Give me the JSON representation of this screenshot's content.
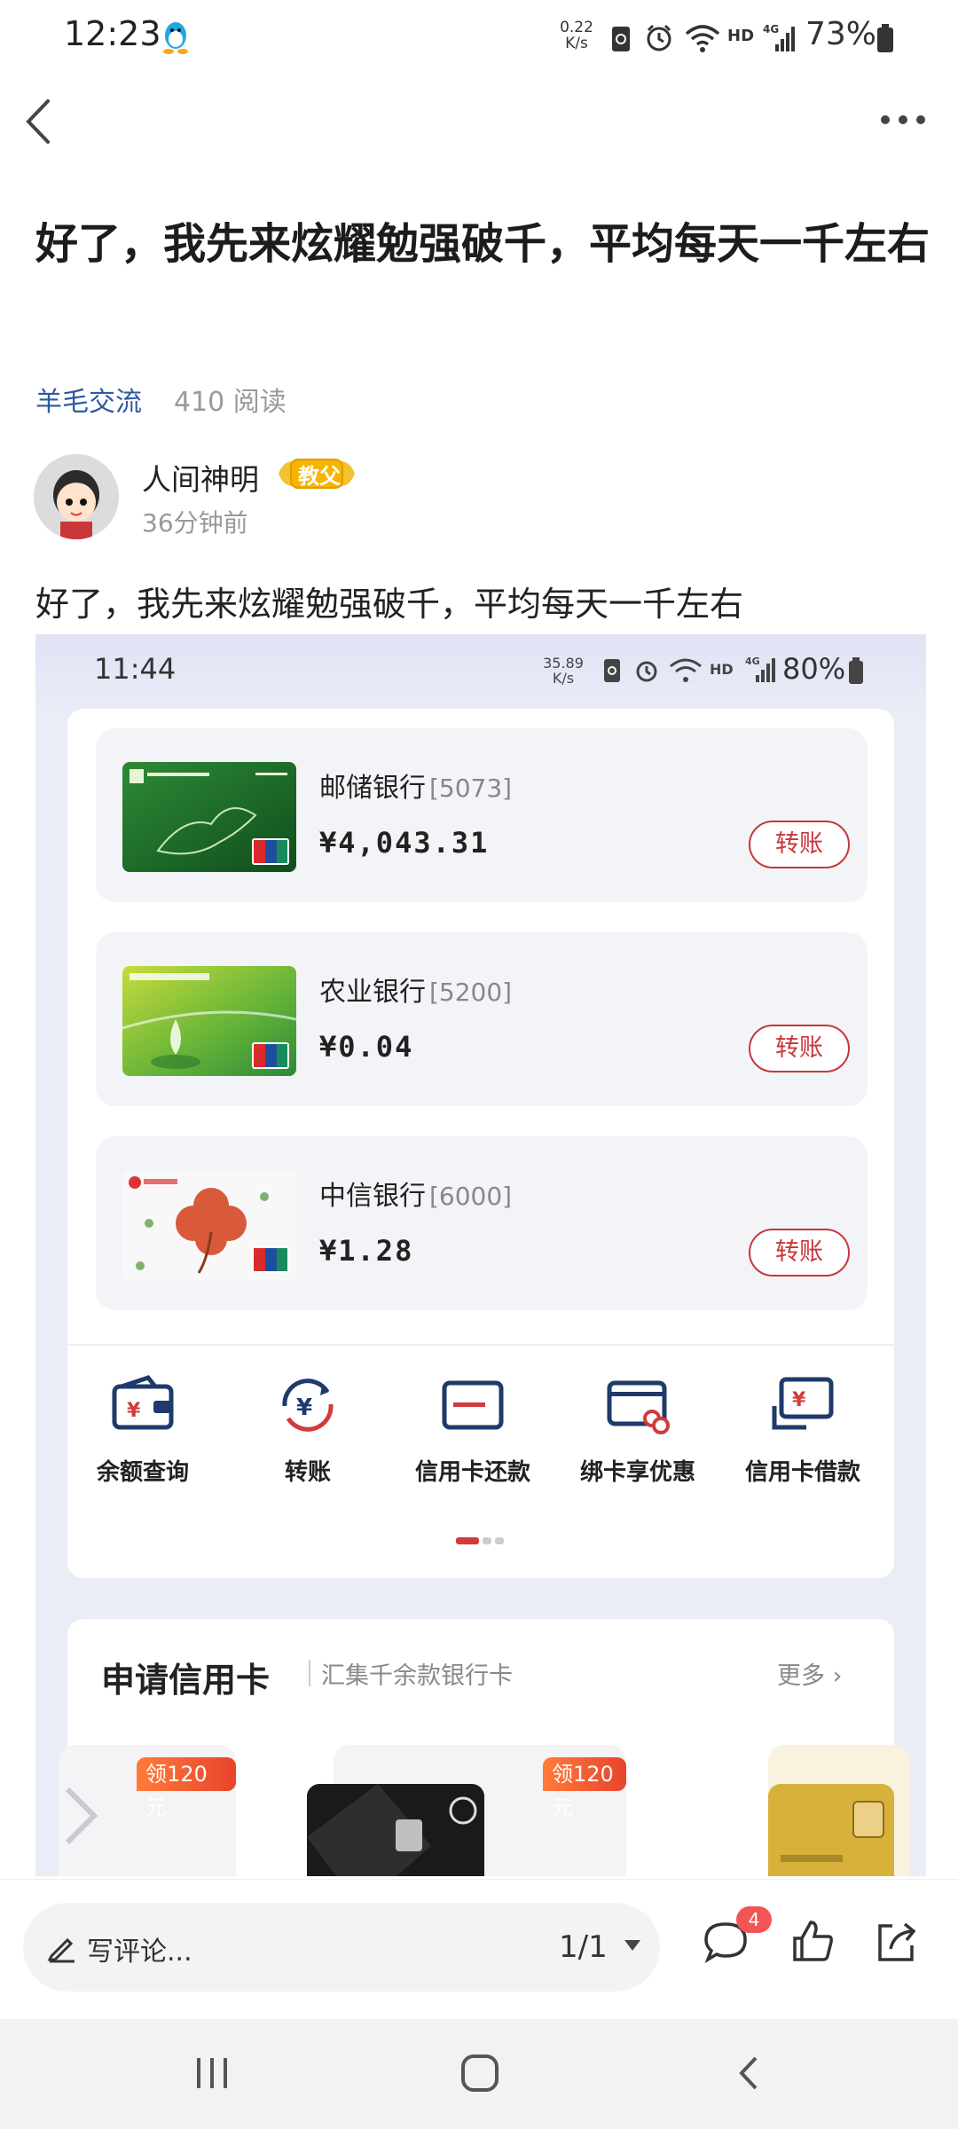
{
  "status_bar": {
    "time": "12:23",
    "speed_value": "0.22",
    "speed_unit": "K/s",
    "hd": "HD",
    "network": "4G",
    "battery": "73%"
  },
  "post": {
    "title": "好了，我先来炫耀勉强破千，平均每天一千左右",
    "tag": "羊毛交流",
    "reads": "410 阅读",
    "author": "人间神明",
    "badge": "教父",
    "time_ago": "36分钟前",
    "body": "好了，我先来炫耀勉强破千，平均每天一千左右"
  },
  "embedded": {
    "status": {
      "time": "11:44",
      "speed_value": "35.89",
      "speed_unit": "K/s",
      "hd": "HD",
      "network": "4G",
      "battery": "80%"
    },
    "cards": [
      {
        "name": "邮储银行",
        "number": "[5073]",
        "balance": "¥4,043.31",
        "action": "转账",
        "colors": [
          "#1f6a2a",
          "#3a9a3a"
        ]
      },
      {
        "name": "农业银行",
        "number": "[5200]",
        "balance": "¥0.04",
        "action": "转账",
        "colors": [
          "#b5d335",
          "#3d9a3a"
        ]
      },
      {
        "name": "中信银行",
        "number": "[6000]",
        "balance": "¥1.28",
        "action": "转账",
        "colors": [
          "#fafafa",
          "#e6e6e6"
        ]
      }
    ],
    "functions": [
      {
        "label": "余额查询",
        "icon": "wallet-icon"
      },
      {
        "label": "转账",
        "icon": "transfer-yuan-icon"
      },
      {
        "label": "信用卡还款",
        "icon": "credit-card-icon"
      },
      {
        "label": "绑卡享优惠",
        "icon": "bind-card-icon"
      },
      {
        "label": "信用卡借款",
        "icon": "card-loan-icon"
      }
    ],
    "credit": {
      "title": "申请信用卡",
      "subtitle": "汇集千余款银行卡",
      "more": "更多",
      "promos": [
        "领120元",
        "领120元"
      ]
    },
    "accent": "#c8363a",
    "icon_navy": "#1f3a6b"
  },
  "bottom_bar": {
    "comment_placeholder": "写评论...",
    "page": "1/1",
    "comment_count": "4"
  }
}
